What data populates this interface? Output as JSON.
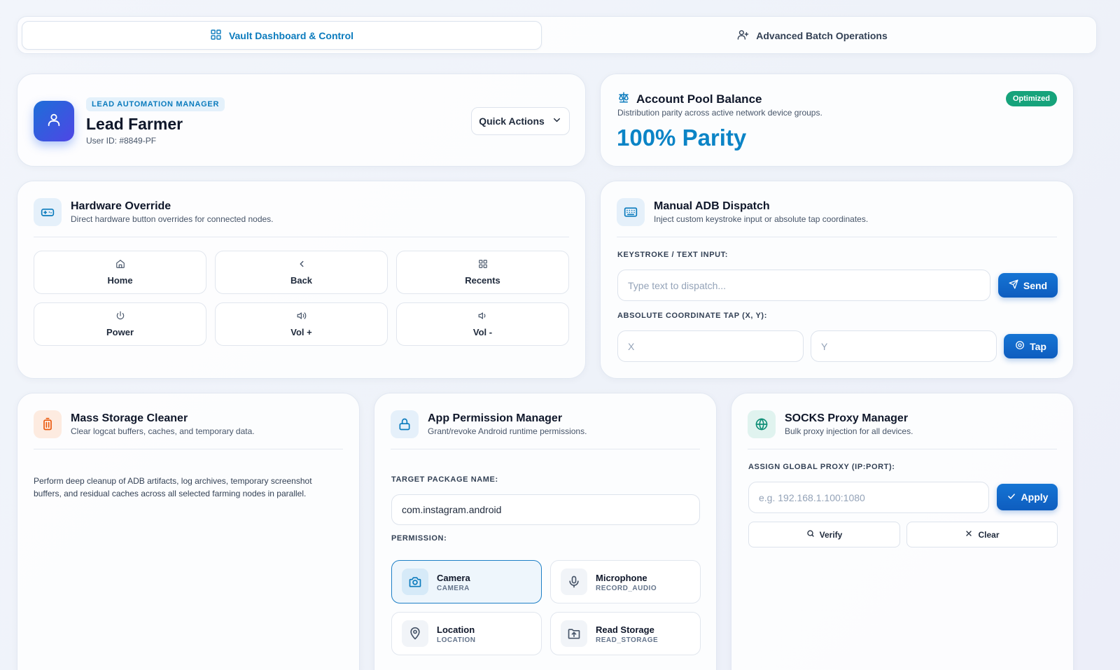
{
  "tabs": [
    {
      "label": "Vault Dashboard & Control",
      "icon": "grid-icon",
      "active": true
    },
    {
      "label": "Advanced Batch Operations",
      "icon": "user-plus-icon",
      "active": false
    }
  ],
  "profile": {
    "role": "LEAD AUTOMATION MANAGER",
    "name": "Lead Farmer",
    "user_id": "User ID: #8849-PF",
    "quick_actions_label": "Quick Actions"
  },
  "balance": {
    "title": "Account Pool Balance",
    "subtitle": "Distribution parity across active network device groups.",
    "value": "100% Parity",
    "badge": "Optimized",
    "badge_color": "#16a37b"
  },
  "hardware": {
    "title": "Hardware Override",
    "subtitle": "Direct hardware button overrides for connected nodes.",
    "buttons": [
      {
        "label": "Home",
        "icon": "home-icon"
      },
      {
        "label": "Back",
        "icon": "chevron-left-icon"
      },
      {
        "label": "Recents",
        "icon": "grid-icon"
      },
      {
        "label": "Power",
        "icon": "power-icon"
      },
      {
        "label": "Vol +",
        "icon": "volume-up-icon"
      },
      {
        "label": "Vol -",
        "icon": "volume-down-icon"
      }
    ]
  },
  "adb": {
    "title": "Manual ADB Dispatch",
    "subtitle": "Inject custom keystroke input or absolute tap coordinates.",
    "keystroke_label": "KEYSTROKE / TEXT INPUT:",
    "keystroke_placeholder": "Type text to dispatch...",
    "send_label": "Send",
    "coord_label": "ABSOLUTE COORDINATE TAP (X, Y):",
    "x_placeholder": "X",
    "y_placeholder": "Y",
    "tap_label": "Tap"
  },
  "storage": {
    "title": "Mass Storage Cleaner",
    "subtitle": "Clear logcat buffers, caches, and temporary data.",
    "description": "Perform deep cleanup of ADB artifacts, log archives, temporary screenshot buffers, and residual caches across all selected farming nodes in parallel."
  },
  "permissions": {
    "title": "App Permission Manager",
    "subtitle": "Grant/revoke Android runtime permissions.",
    "package_label": "TARGET PACKAGE NAME:",
    "package_value": "com.instagram.android",
    "permission_label": "PERMISSION:",
    "items": [
      {
        "name": "Camera",
        "code": "CAMERA",
        "icon": "camera-icon",
        "selected": true
      },
      {
        "name": "Microphone",
        "code": "RECORD_AUDIO",
        "icon": "microphone-icon",
        "selected": false
      },
      {
        "name": "Location",
        "code": "LOCATION",
        "icon": "map-pin-icon",
        "selected": false
      },
      {
        "name": "Read Storage",
        "code": "READ_STORAGE",
        "icon": "folder-upload-icon",
        "selected": false
      }
    ]
  },
  "proxy": {
    "title": "SOCKS Proxy Manager",
    "subtitle": "Bulk proxy injection for all devices.",
    "assign_label": "ASSIGN GLOBAL PROXY (IP:PORT):",
    "proxy_placeholder": "e.g. 192.168.1.100:1080",
    "apply_label": "Apply",
    "verify_label": "Verify",
    "clear_label": "Clear"
  },
  "colors": {
    "accent": "#0b7bbd",
    "primary_button": "#1574d4",
    "success": "#16a37b"
  }
}
